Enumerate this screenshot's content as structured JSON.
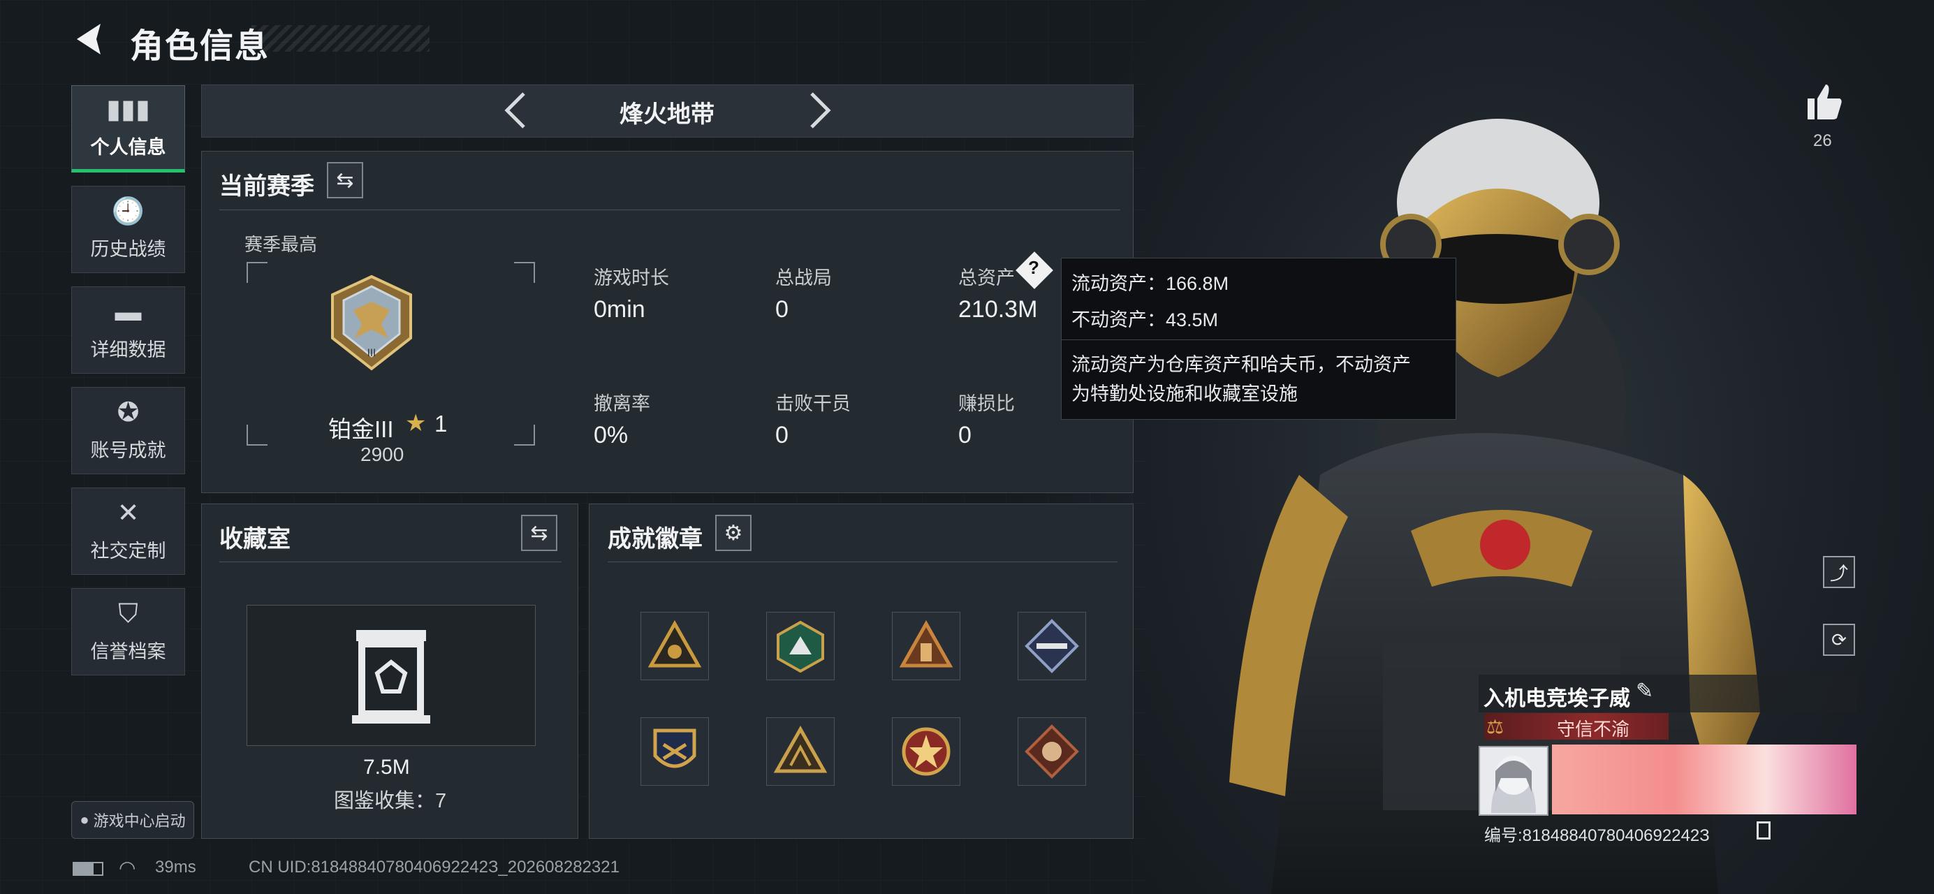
{
  "header": {
    "title": "角色信息"
  },
  "sidebar": {
    "items": [
      {
        "label": "个人信息",
        "icon": "bar-chart-icon"
      },
      {
        "label": "历史战绩",
        "icon": "clock-icon"
      },
      {
        "label": "详细数据",
        "icon": "folder-icon"
      },
      {
        "label": "账号成就",
        "icon": "medal-icon"
      },
      {
        "label": "社交定制",
        "icon": "tools-icon"
      },
      {
        "label": "信誉档案",
        "icon": "shield-icon"
      }
    ],
    "game_center": "游戏中心启动"
  },
  "mode": {
    "label": "烽火地带"
  },
  "season": {
    "title": "当前赛季",
    "highest_label": "赛季最高",
    "rank": "铂金III",
    "rank_stars": "1",
    "rank_score": "2900",
    "stats": [
      {
        "label": "游戏时长",
        "value": "0min"
      },
      {
        "label": "总战局",
        "value": "0"
      },
      {
        "label": "总资产",
        "value": "210.3M"
      },
      {
        "label": "撤离率",
        "value": "0%"
      },
      {
        "label": "击败干员",
        "value": "0"
      },
      {
        "label": "赚损比",
        "value": "0"
      }
    ]
  },
  "tooltip": {
    "line1": "流动资产：166.8M",
    "line2": "不动资产：43.5M",
    "desc1": "流动资产为仓库资产和哈夫币，不动资产",
    "desc2": "为特勤处设施和收藏室设施"
  },
  "collection": {
    "title": "收藏室",
    "value": "7.5M",
    "count": "图鉴收集：7"
  },
  "achievements": {
    "title": "成就徽章",
    "badges": [
      {
        "icon": "triangle-emblem-icon",
        "color": "#c99a3e"
      },
      {
        "icon": "hexagon-emblem-icon",
        "color": "#3f9a70"
      },
      {
        "icon": "triangle-tower-icon",
        "color": "#c9853e"
      },
      {
        "icon": "diamond-weapon-icon",
        "color": "#8fa0c8"
      },
      {
        "icon": "shield-emblem-icon",
        "color": "#d1a34b"
      },
      {
        "icon": "triangle-beast-icon",
        "color": "#c9a04b"
      },
      {
        "icon": "star-emblem-icon",
        "color": "#c04a3e"
      },
      {
        "icon": "diamond-beast-icon",
        "color": "#b0603e"
      }
    ]
  },
  "profile": {
    "likes": "26",
    "name": "入机电竞埃子威",
    "motto": "守信不渝",
    "id_text": "编号:8184884078040692242З"
  },
  "status": {
    "ping": "39ms",
    "uid": "CN UID:8184884078040692242З_202608282321"
  },
  "colors": {
    "accent_green": "#25c26e",
    "gold": "#c9a04b"
  }
}
